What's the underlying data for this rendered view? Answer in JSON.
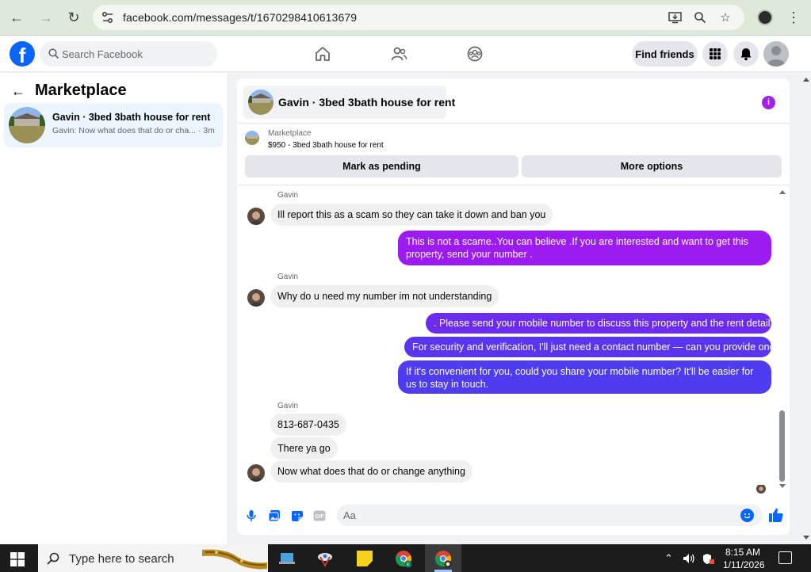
{
  "browser": {
    "url": "facebook.com/messages/t/1670298410613679"
  },
  "fb": {
    "search_placeholder": "Search Facebook",
    "find_friends": "Find friends"
  },
  "left_panel": {
    "title": "Marketplace",
    "conversation": {
      "title": "Gavin · 3bed 3bath house for rent",
      "preview": "Gavin: Now what does that do or cha... · 3m"
    }
  },
  "chat": {
    "header_title": "Gavin · 3bed 3bath house for rent",
    "listing_label": "Marketplace",
    "listing_price": "$950 - 3bed 3bath house for rent",
    "mark_pending": "Mark as pending",
    "more_options": "More options",
    "messages": [
      {
        "sender": "Gavin",
        "text": "Ill report this as a scam so they can take it down and ban you"
      },
      {
        "text": "This is not a scame..You can believe .If you are interested and want to get this property, send your number ."
      },
      {
        "sender": "Gavin",
        "text": "Why do u need my number im not understanding"
      },
      {
        "text": ". Please send your mobile number to discuss this property and the rent detail's."
      },
      {
        "text": "For security and verification, I'll just need a contact number — can you provide one?"
      },
      {
        "text": "If it's convenient for you, could you share your mobile number? It'll be easier for us to stay in touch."
      },
      {
        "sender": "Gavin",
        "text": "813-687-0435"
      },
      {
        "text": "There ya go"
      },
      {
        "text": "Now what does that do or change anything"
      }
    ],
    "composer_placeholder": "Aa"
  },
  "taskbar": {
    "search_text": "Type here to search",
    "time": "8:15 AM",
    "date": "1/11/2026"
  },
  "colors": {
    "fb_blue": "#0866ff",
    "bubble_purple": "#9b1bf2",
    "bubble_blue": "#4d3cf0",
    "convo_highlight": "#ebf5ff"
  }
}
